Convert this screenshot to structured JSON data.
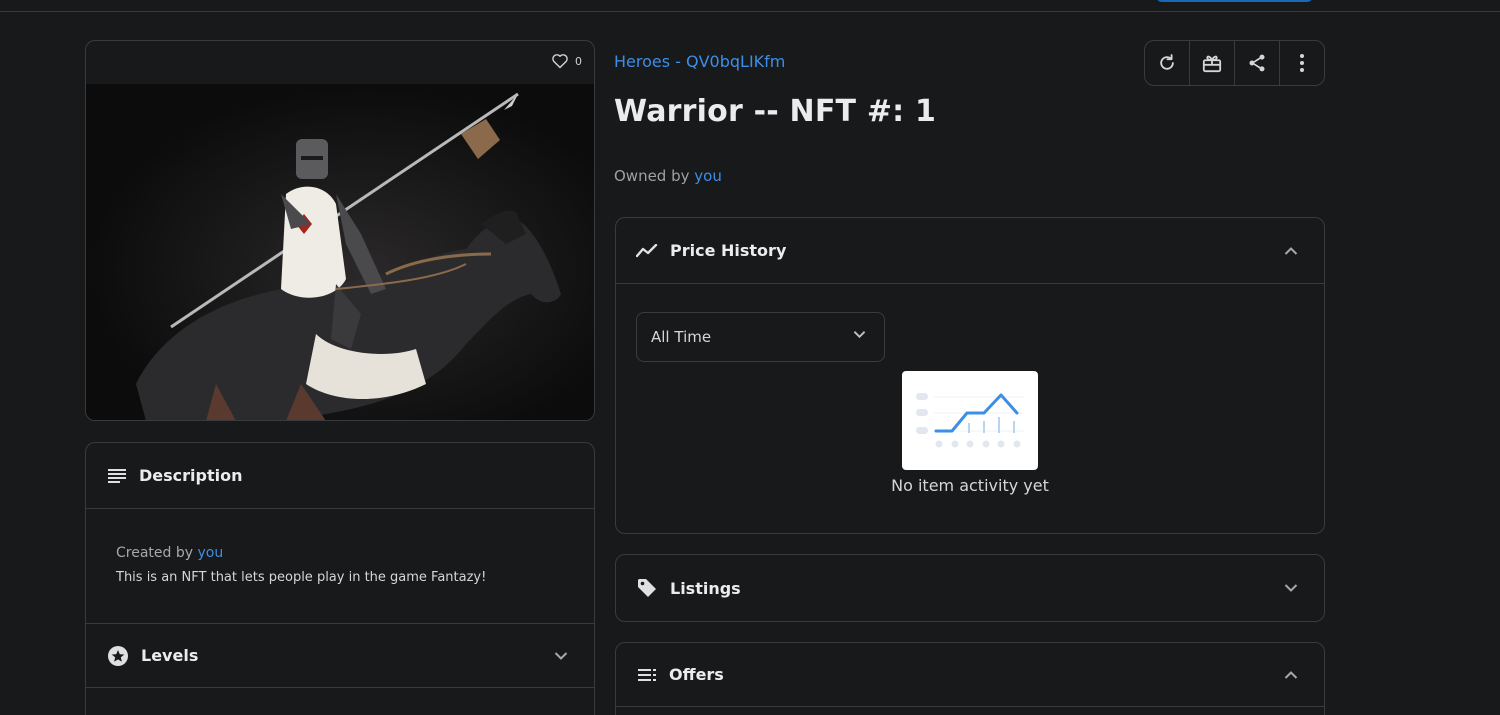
{
  "asset": {
    "like_count": "0",
    "collection": "Heroes - QV0bqLIKfm",
    "title": "Warrior -- NFT #: 1",
    "owned_prefix": "Owned by",
    "owner": "you"
  },
  "description": {
    "heading": "Description",
    "created_prefix": "Created by",
    "creator": "you",
    "text": "This is an NFT that lets people play in the game Fantazy!"
  },
  "levels": {
    "heading": "Levels"
  },
  "price_history": {
    "heading": "Price History",
    "range_selected": "All Time",
    "empty_text": "No item activity yet"
  },
  "listings": {
    "heading": "Listings"
  },
  "offers": {
    "heading": "Offers"
  },
  "colors": {
    "accent": "#3d8ee6",
    "background": "#18191b",
    "border": "#3a3b3e"
  }
}
